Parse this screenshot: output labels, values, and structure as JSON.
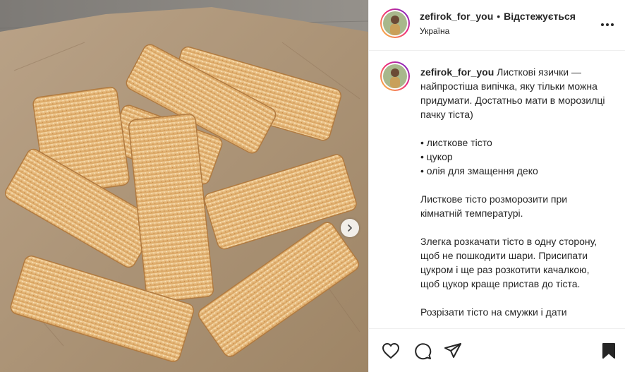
{
  "post": {
    "media": {
      "description_icon": "photo-of-puff-pastry",
      "next_icon": "chevron-right-icon"
    },
    "author": {
      "username": "zefirok_for_you",
      "separator": "•",
      "follow_state": "Відстежується",
      "location": "Україна",
      "avatar_icon": "user-avatar-icon"
    },
    "more_icon": "more-options-icon",
    "caption": {
      "username": "zefirok_for_you",
      "intro": " Листкові язички — найпростіша випічка, яку тільки можна придумати. Достатньо мати в морозилці пачку тіста)",
      "ingredients": [
        "• листкове тісто",
        "• цукор",
        "• олія для змащення деко"
      ],
      "step1": "Листкове тісто розморозити при кімнатній температурі.",
      "step2": "Злегка розкачати тісто в одну сторону, щоб не пошкодити шари. Присипати цукром і ще раз розкотити качалкою, щоб цукор краще пристав до тіста.",
      "step3": "Розрізати тісто на смужки і дати"
    },
    "actions": {
      "like_icon": "heart-icon",
      "comment_icon": "comment-icon",
      "share_icon": "share-icon",
      "save_icon": "bookmark-icon"
    },
    "colors": {
      "avatar_ring_start": "#f9ce34",
      "avatar_ring_end": "#6228d7",
      "divider": "#efefef",
      "text": "#262626"
    }
  }
}
